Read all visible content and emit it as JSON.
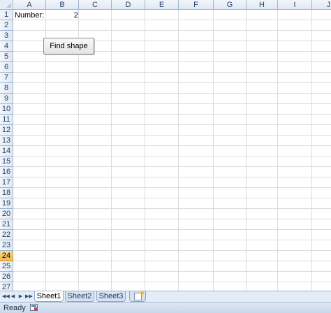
{
  "columns": [
    "A",
    "B",
    "C",
    "D",
    "E",
    "F",
    "G",
    "H",
    "I",
    "J"
  ],
  "rows": [
    "1",
    "2",
    "3",
    "4",
    "5",
    "6",
    "7",
    "8",
    "9",
    "10",
    "11",
    "12",
    "13",
    "14",
    "15",
    "16",
    "17",
    "18",
    "19",
    "20",
    "21",
    "22",
    "23",
    "24",
    "25",
    "26",
    "27"
  ],
  "active_row": "24",
  "cells": {
    "a1": "Number:",
    "b1": "2"
  },
  "button": {
    "label": "Find shape"
  },
  "nav": {
    "first": "◀◀",
    "prev": "◀",
    "next": "▶",
    "last": "▶▶"
  },
  "sheets": [
    "Sheet1",
    "Sheet2",
    "Sheet3"
  ],
  "active_sheet": "Sheet1",
  "status": {
    "text": "Ready"
  },
  "icons": {
    "insert_sheet": "insert-worksheet-icon",
    "macro": "macro-record-icon"
  },
  "colors": {
    "header_bg": "#e4ecf7",
    "active_row_header": "#f3b84a",
    "gridline": "#dadcdd"
  }
}
